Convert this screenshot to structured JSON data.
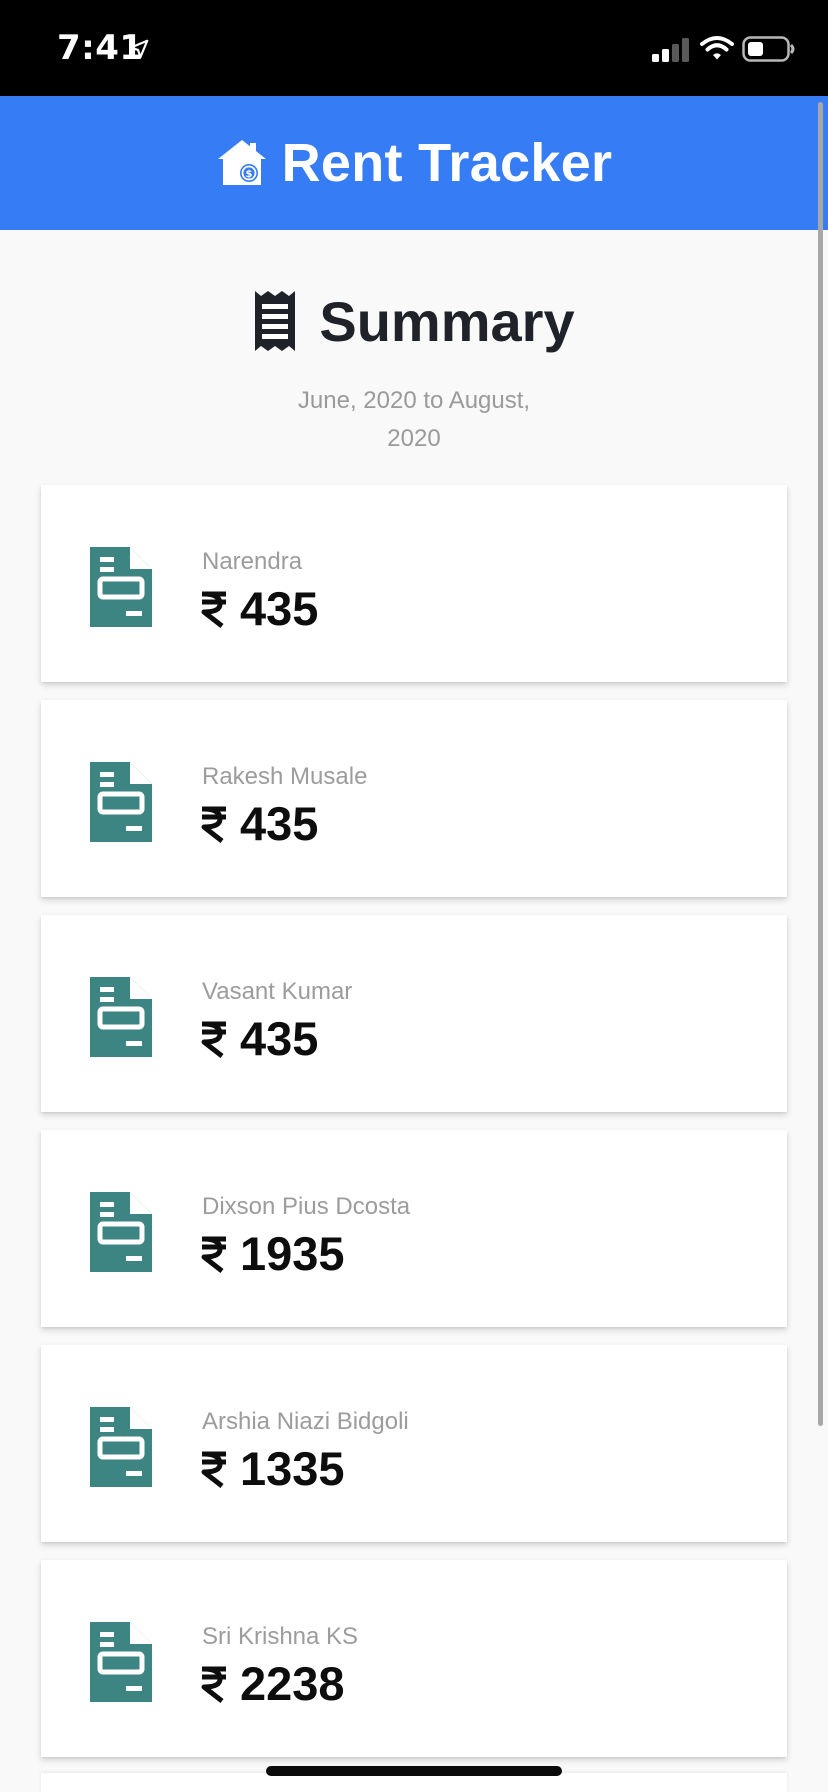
{
  "status_bar": {
    "time": "7:41",
    "icons": [
      "location-arrow-icon",
      "cellular-signal-icon",
      "wifi-icon",
      "battery-icon"
    ]
  },
  "header": {
    "title": "Rent Tracker",
    "icon": "house-money-icon",
    "background_color": "#357cf5"
  },
  "summary": {
    "title": "Summary",
    "icon": "receipt-icon",
    "date_range_line1": "June, 2020 to August,",
    "date_range_line2": "2020"
  },
  "tenants": [
    {
      "name": "Narendra",
      "currency": "₹",
      "amount": "435",
      "icon": "document-icon"
    },
    {
      "name": "Rakesh Musale",
      "currency": "₹",
      "amount": "435",
      "icon": "document-icon"
    },
    {
      "name": "Vasant Kumar",
      "currency": "₹",
      "amount": "435",
      "icon": "document-icon"
    },
    {
      "name": "Dixson Pius Dcosta",
      "currency": "₹",
      "amount": "1935",
      "icon": "document-icon"
    },
    {
      "name": "Arshia Niazi Bidgoli",
      "currency": "₹",
      "amount": "1335",
      "icon": "document-icon"
    },
    {
      "name": "Sri Krishna KS",
      "currency": "₹",
      "amount": "2238",
      "icon": "document-icon"
    }
  ],
  "colors": {
    "accent": "#357cf5",
    "document_icon": "#3c8583",
    "heading_text": "#1f2229",
    "muted_text": "#9c9c9c",
    "background": "#f9f9f9"
  }
}
